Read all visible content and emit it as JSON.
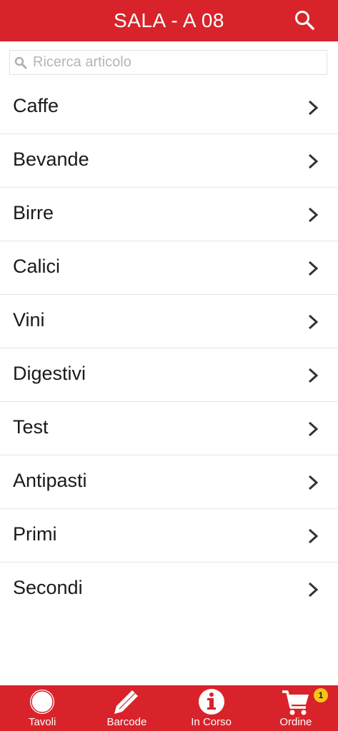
{
  "header": {
    "title": "SALA - A 08",
    "search_icon": "search-icon"
  },
  "search": {
    "placeholder": "Ricerca articolo",
    "value": ""
  },
  "categories": [
    {
      "label": "Caffe"
    },
    {
      "label": "Bevande"
    },
    {
      "label": "Birre"
    },
    {
      "label": "Calici"
    },
    {
      "label": "Vini"
    },
    {
      "label": "Digestivi"
    },
    {
      "label": "Test"
    },
    {
      "label": "Antipasti"
    },
    {
      "label": "Primi"
    },
    {
      "label": "Secondi"
    }
  ],
  "tabbar": {
    "tabs": [
      {
        "label": "Tavoli",
        "icon": "circle-icon"
      },
      {
        "label": "Barcode",
        "icon": "pencil-icon"
      },
      {
        "label": "In Corso",
        "icon": "info-icon"
      },
      {
        "label": "Ordine",
        "icon": "cart-icon",
        "badge": "1"
      }
    ]
  },
  "colors": {
    "brand": "#d8232a",
    "badge": "#f5c518"
  }
}
